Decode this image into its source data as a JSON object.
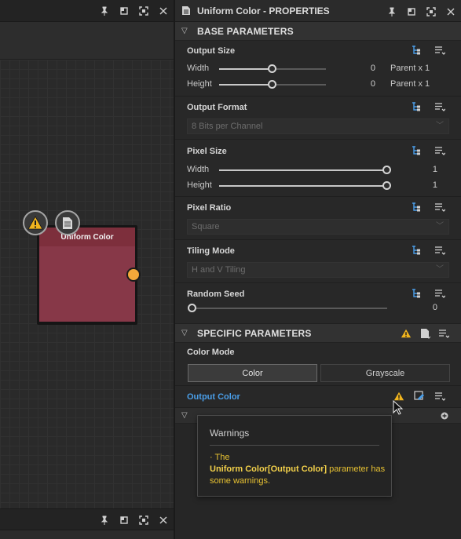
{
  "graph_panel": {
    "node": {
      "title": "Uniform Color"
    }
  },
  "properties": {
    "title": "Uniform Color - PROPERTIES",
    "base_section_title": "BASE PARAMETERS",
    "specific_section_title": "SPECIFIC PARAMETERS",
    "output_size": {
      "label": "Output Size",
      "width_label": "Width",
      "width_value": "0",
      "width_mode": "Parent x 1",
      "height_label": "Height",
      "height_value": "0",
      "height_mode": "Parent x 1"
    },
    "output_format": {
      "label": "Output Format",
      "value": "8 Bits per Channel"
    },
    "pixel_size": {
      "label": "Pixel Size",
      "width_label": "Width",
      "width_value": "1",
      "height_label": "Height",
      "height_value": "1"
    },
    "pixel_ratio": {
      "label": "Pixel Ratio",
      "value": "Square"
    },
    "tiling_mode": {
      "label": "Tiling Mode",
      "value": "H and V Tiling"
    },
    "random_seed": {
      "label": "Random Seed",
      "value": "0"
    },
    "color_mode": {
      "label": "Color Mode",
      "options": [
        "Color",
        "Grayscale"
      ],
      "selected": "Color"
    },
    "output_color": {
      "label": "Output Color"
    }
  },
  "tooltip": {
    "title": "Warnings",
    "prefix": "· The",
    "emphasis": "Uniform Color[Output Color]",
    "suffix": " parameter has some warnings."
  },
  "colors": {
    "node_body": "#873848",
    "output_port": "#f3a83a",
    "warning": "#f0b41e",
    "link_blue": "#4a9ee8"
  }
}
